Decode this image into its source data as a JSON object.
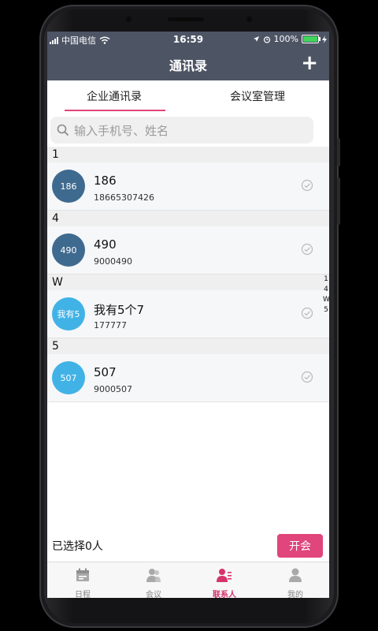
{
  "status": {
    "carrier": "中国电信",
    "time": "16:59",
    "battery": "100%"
  },
  "navbar": {
    "title": "通讯录",
    "add": "+"
  },
  "tabs": [
    {
      "label": "企业通讯录"
    },
    {
      "label": "会议室管理"
    }
  ],
  "search": {
    "placeholder": "输入手机号、姓名"
  },
  "sections": [
    {
      "header": "1",
      "name": "186",
      "phone": "18665307426",
      "avatar": "186",
      "color": "#3f6a8f"
    },
    {
      "header": "4",
      "name": "490",
      "phone": "9000490",
      "avatar": "490",
      "color": "#3f6a8f"
    },
    {
      "header": "W",
      "name": "我有5个7",
      "phone": "177777",
      "avatar": "我有5",
      "color": "#41b2e6"
    },
    {
      "header": "5",
      "name": "507",
      "phone": "9000507",
      "avatar": "507",
      "color": "#41b2e6"
    }
  ],
  "index": [
    "1",
    "4",
    "W",
    "5"
  ],
  "footer": {
    "selected": "已选择0人",
    "start": "开会"
  },
  "tabbar": [
    {
      "label": "日程",
      "icon": "calendar-icon"
    },
    {
      "label": "会议",
      "icon": "meeting-people-icon"
    },
    {
      "label": "联系人",
      "icon": "contacts-icon"
    },
    {
      "label": "我的",
      "icon": "person-icon"
    }
  ],
  "colors": {
    "accent": "#e0457b",
    "header": "#4d5464"
  }
}
